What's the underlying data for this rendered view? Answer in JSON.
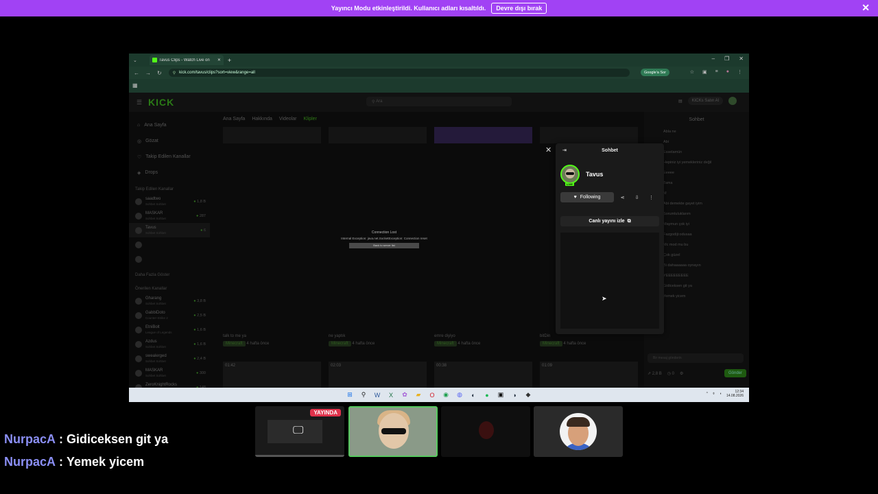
{
  "banner": {
    "text": "Yayıncı Modu etkinleştirildi. Kullanıcı adları kısaltıldı.",
    "disable_label": "Devre dışı bırak",
    "close_icon": "close-icon"
  },
  "browser": {
    "tab_title": "Tavus Clips - Watch Live on",
    "url": "kick.com/tavus/clips?sort=view&range=all",
    "google_button": "Google'a Sor"
  },
  "kick": {
    "logo": "KICK",
    "search_placeholder": "Ara",
    "kicks_button": "KICKs Satın Al",
    "nav": [
      "Ana Sayfa",
      "Gözat",
      "Takip Edilen Kanallar",
      "Drops"
    ],
    "followed_title": "Takip Edilen Kanallar",
    "followed": [
      {
        "name": "saadtwo",
        "sub": "Sohbet Sohbet",
        "viewers": "1,8 B"
      },
      {
        "name": "MASKAR",
        "sub": "Sohbet Sohbet",
        "viewers": "287"
      },
      {
        "name": "Tavus",
        "sub": "Sohbet Sohbet",
        "viewers": "6"
      }
    ],
    "show_more": "Daha Fazla Göster",
    "recommended_title": "Önerilen Kanallar",
    "recommended": [
      {
        "name": "Gharang",
        "sub": "Sohbet Sohbet",
        "viewers": "3,8 B"
      },
      {
        "name": "GabbiDoto",
        "sub": "Counter-Strike 2",
        "viewers": "2,5 B"
      },
      {
        "name": "EtniBolt",
        "sub": "League of Legends",
        "viewers": "1,6 B"
      },
      {
        "name": "Azdus",
        "sub": "Sohbet Sohbet",
        "viewers": "1,6 B"
      },
      {
        "name": "swealerged",
        "sub": "Sohbet Sohbet",
        "viewers": "2,4 B"
      },
      {
        "name": "MASKAR",
        "sub": "Sohbet Sohbet",
        "viewers": "300"
      },
      {
        "name": "ZeroKnightRocks",
        "sub": "Marvel Rivals",
        "viewers": "148"
      }
    ],
    "tabs": [
      "Ana Sayfa",
      "Hakkında",
      "Videolar",
      "Klipler"
    ],
    "clips": [
      {
        "title": "talk to me ya",
        "tag": "Minecraft",
        "age": "4 hafta önce"
      },
      {
        "title": "ne yaptık",
        "tag": "Minecraft",
        "age": "4 hafta önce"
      },
      {
        "title": "emre diyiyo",
        "tag": "Minecraft",
        "age": "4 hafta önce"
      },
      {
        "title": "bitDin",
        "tag": "Minecraft",
        "age": "4 hafta önce"
      }
    ],
    "durations": [
      "01:42",
      "02:03",
      "00:38",
      "01:09"
    ],
    "error": {
      "title": "Connection Lost",
      "message": "Internal Exception: java.net.SocketException: Connection reset",
      "button": "Back to server list"
    }
  },
  "chat_bg": {
    "header": "Sohbet",
    "messages": [
      "Abla ne",
      "Abi",
      "Esselamün",
      "Hepiniz iyi yemekleriniz değil",
      "Eeeee",
      "Tama",
      "M",
      "Abi demekte gayet iyim",
      "Sorumluluklarım",
      "Maymun çok iyi",
      "Fazgodiji:odusaa",
      "Mc mod mu bu",
      "Çok güzel",
      "Bi dahaaaaaa oynayın",
      "YEEEEEEEEE",
      "Gidiceksen git ya",
      "Yemek yicem"
    ],
    "input_placeholder": "Bir mesaj gönderin",
    "send_label": "Gönder",
    "points": "2,8 B",
    "count": "0"
  },
  "popup": {
    "header": "Sohbet",
    "channel": "Tavus",
    "live": "LIVE",
    "follow_label": "Following",
    "watch_label": "Canlı yayını izle"
  },
  "taskbar": {
    "time": "12:34",
    "date": "14.08.2026"
  },
  "overlay_chat": [
    {
      "user": "NurpacA",
      "message": "Gidiceksen git ya"
    },
    {
      "user": "NurpacA",
      "message": "Yemek yicem"
    }
  ],
  "tiles": {
    "live_badge": "YAYINDA"
  }
}
